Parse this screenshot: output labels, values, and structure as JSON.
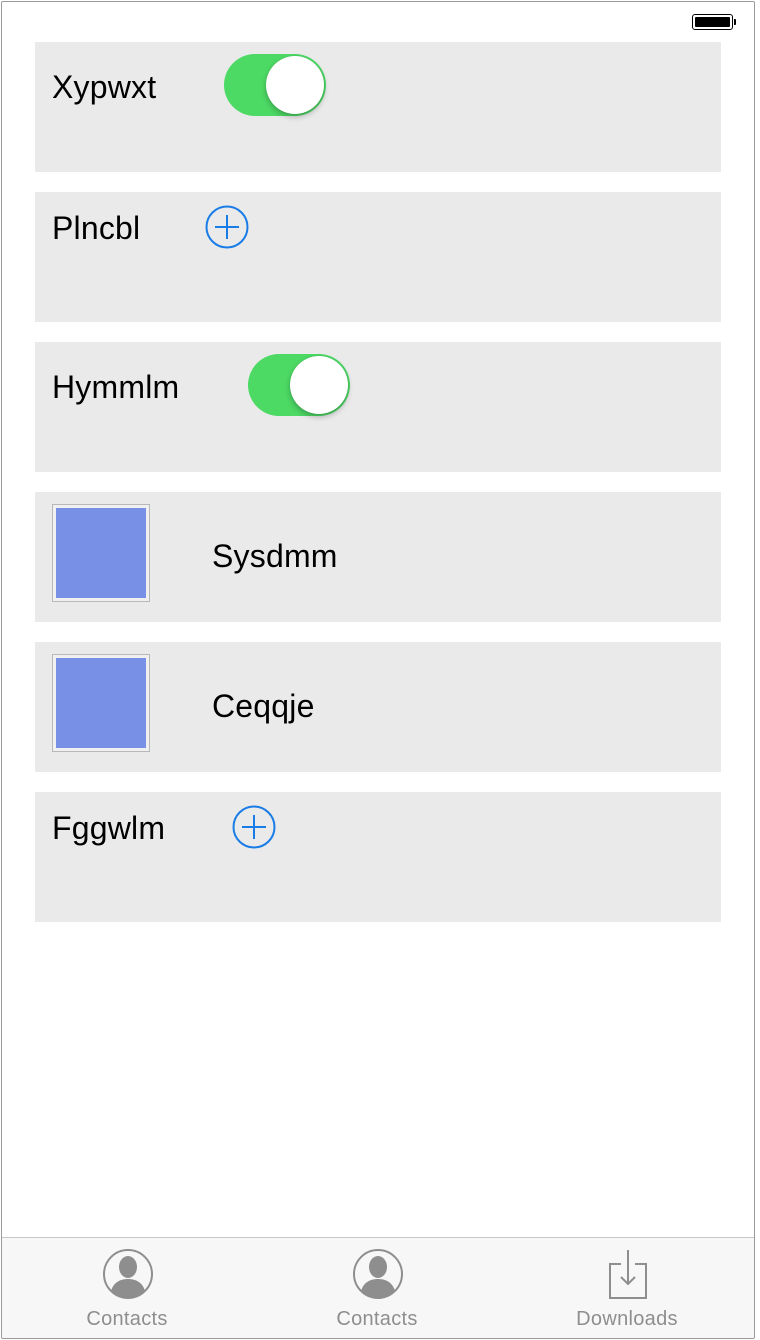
{
  "status_bar": {
    "battery_icon": "battery-full-icon"
  },
  "rows": [
    {
      "type": "toggle",
      "label": "Xypwxt",
      "toggle_on": true
    },
    {
      "type": "add",
      "label": "Plncbl",
      "icon": "add-circle-icon"
    },
    {
      "type": "toggle",
      "label": "Hymmlm",
      "toggle_on": true
    },
    {
      "type": "image",
      "label": "Sysdmm"
    },
    {
      "type": "image",
      "label": "Ceqqje"
    },
    {
      "type": "add",
      "label": "Fggwlm",
      "icon": "add-circle-icon"
    }
  ],
  "tab_bar": {
    "tabs": [
      {
        "label": "Contacts",
        "icon": "contact-icon"
      },
      {
        "label": "Contacts",
        "icon": "contact-icon"
      },
      {
        "label": "Downloads",
        "icon": "download-icon"
      }
    ]
  },
  "colors": {
    "row_background": "#eaeaea",
    "toggle_on": "#4cd964",
    "add_icon": "#1a7ce6",
    "thumbnail": "#7890e6",
    "tab_label": "#8e8e8e"
  }
}
